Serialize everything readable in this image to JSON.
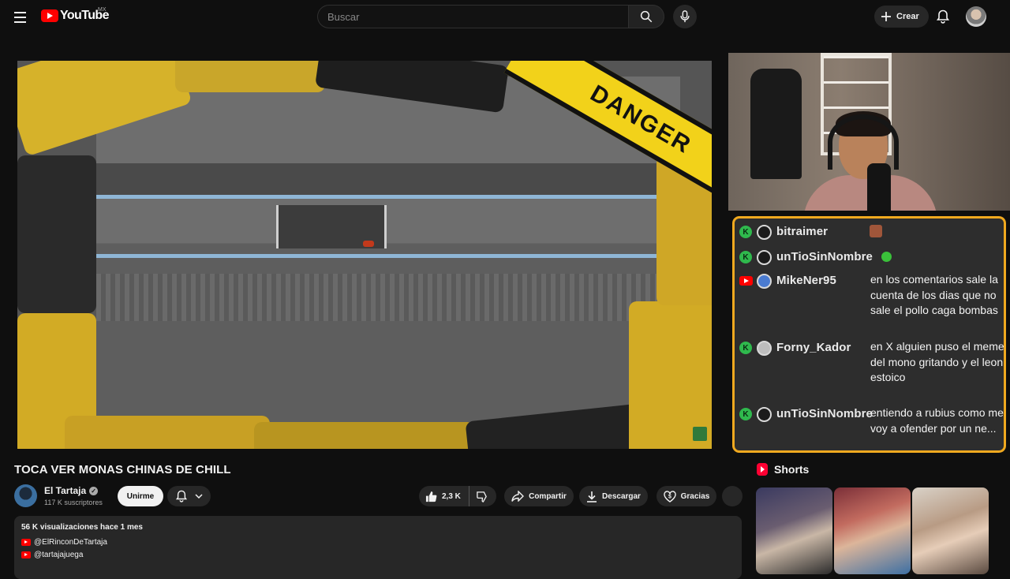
{
  "header": {
    "logo_text": "YouTube",
    "country": "MX",
    "search_placeholder": "Buscar",
    "create_label": "Crear"
  },
  "player": {
    "overlay_text": "DANGER"
  },
  "video": {
    "title": "TOCA VER MONAS CHINAS DE CHILL",
    "channel": {
      "name": "El Tartaja",
      "subscribers": "117 K suscriptores",
      "join_label": "Unirme"
    },
    "actions": {
      "likes": "2,3 K",
      "share": "Compartir",
      "download": "Descargar",
      "thanks": "Gracias"
    },
    "description": {
      "meta": "56 K visualizaciones  hace 1 mes",
      "links": [
        "@ElRinconDeTartaja",
        "@tartajajuega"
      ]
    }
  },
  "chat": {
    "messages": [
      {
        "badge": "K",
        "platform": "kick",
        "user": "bitraimer",
        "text": ""
      },
      {
        "badge": "K",
        "platform": "kick",
        "user": "unTioSinNombre",
        "text": ""
      },
      {
        "badge": "",
        "platform": "youtube",
        "user": "MikeNer95",
        "text": "en los comentarios sale la cuenta de los dias que no sale el pollo caga bombas"
      },
      {
        "badge": "K",
        "platform": "kick",
        "user": "Forny_Kador",
        "text": "en X alguien puso el meme del mono gritando y el leon estoico"
      },
      {
        "badge": "K",
        "platform": "kick",
        "user": "unTioSinNombre",
        "text": "entiendo a rubius como me voy a ofender por un ne..."
      }
    ]
  },
  "shorts": {
    "label": "Shorts"
  },
  "colors": {
    "background": "#0f0f0f",
    "brand_red": "#ff0000",
    "chat_border": "#f0a91f",
    "kick_green": "#2fb94d"
  }
}
